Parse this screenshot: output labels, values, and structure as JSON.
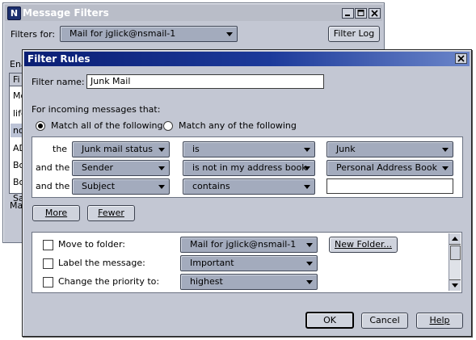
{
  "message_filters": {
    "title": "Message Filters",
    "filters_for_label": "Filters for:",
    "filters_for_value": "Mail for jglick@nsmail-1",
    "filter_log_label": "Filter Log",
    "enable_label": "Ena",
    "list_header": "Fi",
    "list_items": [
      "Mo",
      "life",
      "no",
      "AD",
      "Bo",
      "Bo",
      "Sa"
    ],
    "bottom_label": "Ma"
  },
  "filter_rules": {
    "title": "Filter Rules",
    "filter_name_label": "Filter name:",
    "filter_name_value": "Junk Mail",
    "incoming_label": "For incoming messages that:",
    "match_all_label": "Match all of the following",
    "match_any_label": "Match any of the following",
    "conditions": [
      {
        "prefix": "the",
        "field": "Junk mail status",
        "operator": "is",
        "value": "Junk",
        "value_type": "dropdown"
      },
      {
        "prefix": "and the",
        "field": "Sender",
        "operator": "is not in my address book",
        "value": "Personal Address Book",
        "value_type": "dropdown"
      },
      {
        "prefix": "and the",
        "field": "Subject",
        "operator": "contains",
        "value": "",
        "value_type": "text"
      }
    ],
    "more_label": "More",
    "fewer_label": "Fewer",
    "actions": [
      {
        "label": "Move to folder:",
        "value": "Mail for jglick@nsmail-1"
      },
      {
        "label": "Label the message:",
        "value": "Important"
      },
      {
        "label": "Change the priority to:",
        "value": "highest"
      }
    ],
    "new_folder_label": "New Folder...",
    "ok_label": "OK",
    "cancel_label": "Cancel",
    "help_label": "Help"
  },
  "colors": {
    "titlebar_active": "#0a1e74",
    "titlebar_inactive": "#b9bdc8",
    "window_bg": "#c3c7d3",
    "dropdown_bg": "#a3abbd"
  },
  "icons": [
    "app-logo-icon",
    "minimize-icon",
    "maximize-icon",
    "close-icon",
    "chevron-down-icon",
    "scroll-up-icon",
    "scroll-down-icon"
  ]
}
